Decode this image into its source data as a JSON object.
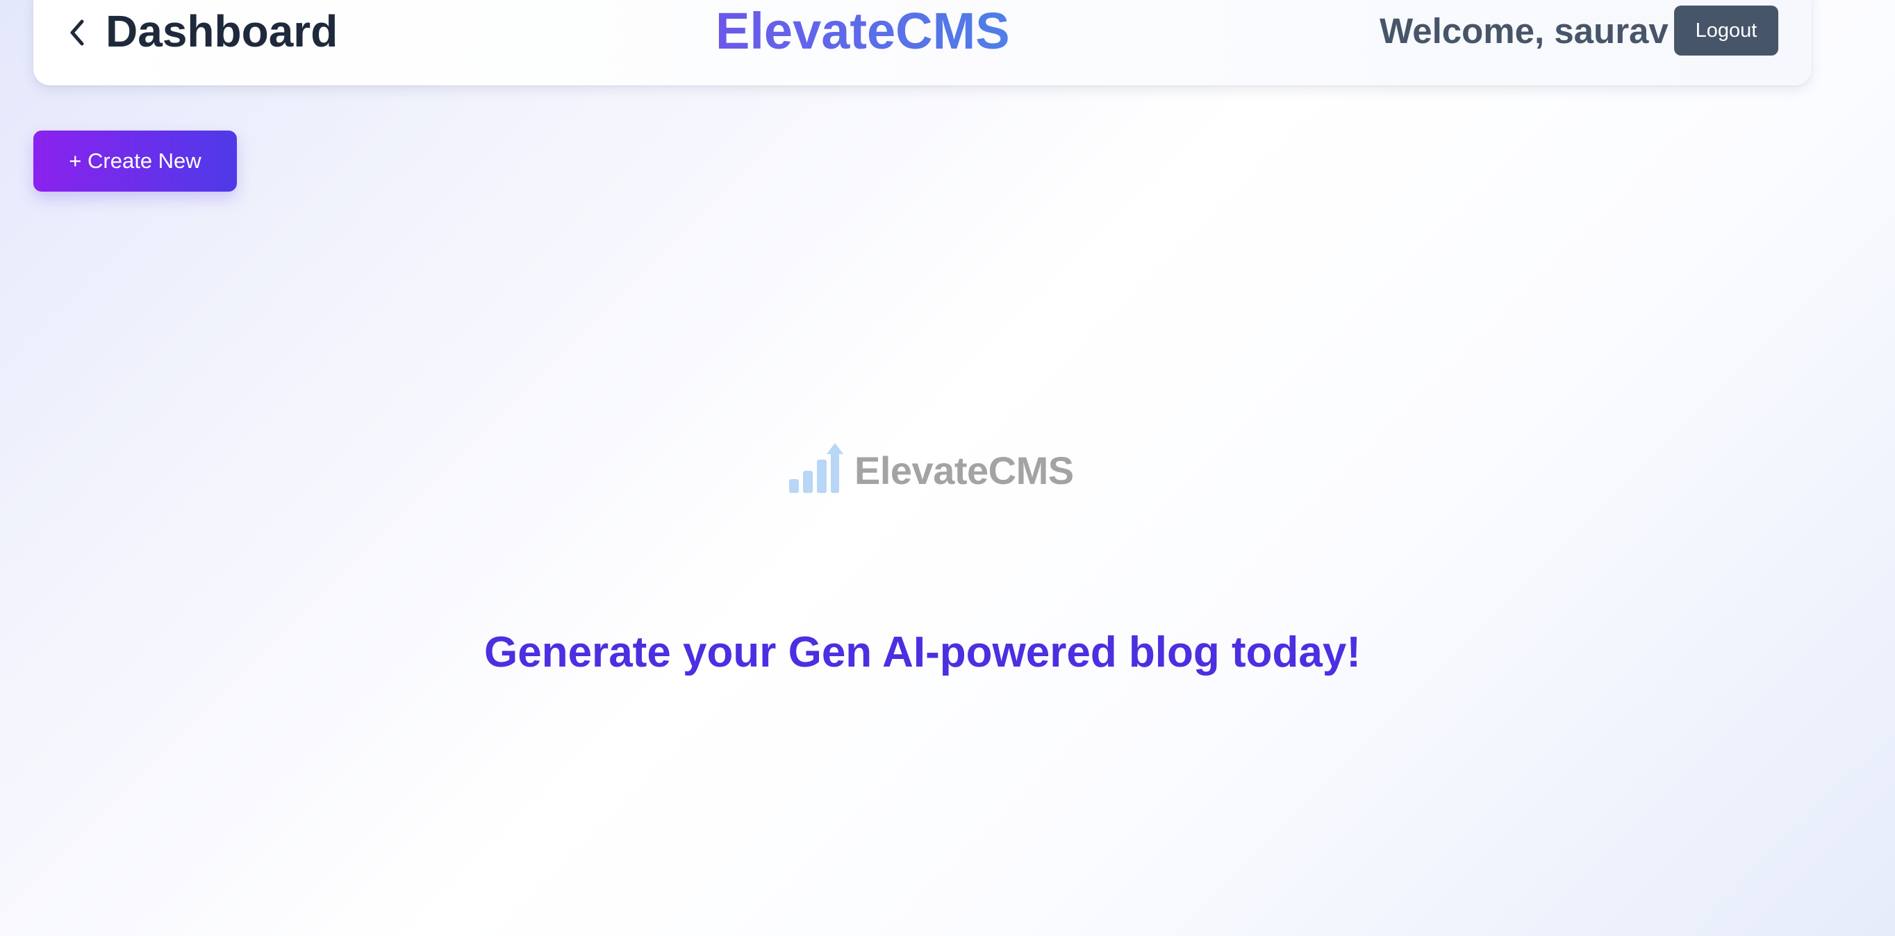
{
  "header": {
    "back_icon": "chevron-left-icon",
    "page_title": "Dashboard",
    "brand_title": "ElevateCMS",
    "welcome_text": "Welcome, saurav",
    "logout_label": "Logout"
  },
  "actions": {
    "create_label": "+ Create New"
  },
  "main": {
    "logo_icon": "bar-chart-arrow-icon",
    "logo_text": "ElevateCMS",
    "tagline": "Generate your Gen AI-powered blog today!"
  },
  "colors": {
    "brand_gradient_start": "#6a58ea",
    "brand_gradient_end": "#4f7fe8",
    "create_gradient_start": "#8b22ee",
    "create_gradient_end": "#4f3ae8",
    "tagline": "#4b2fe0",
    "logout_bg": "#475569",
    "title_text": "#1e293b",
    "logo_bars": "#b8d6f5",
    "logo_text": "#a3a3a3"
  }
}
